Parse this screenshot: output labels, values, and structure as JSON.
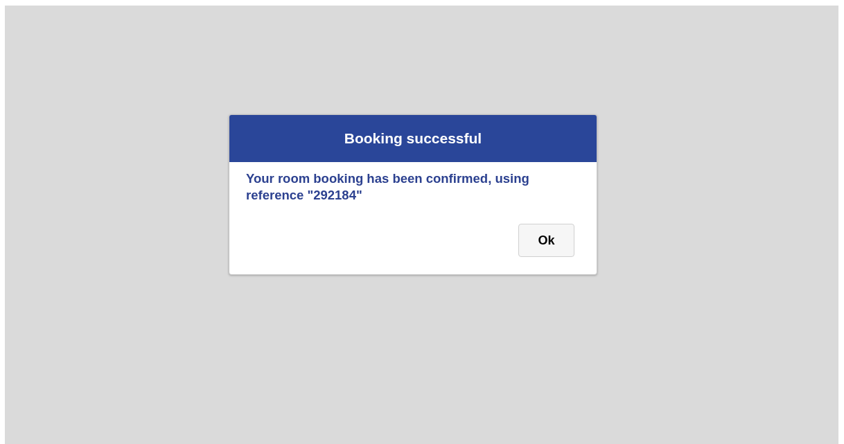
{
  "dialog": {
    "title": "Booking successful",
    "message": "Your room booking has been confirmed, using reference \"292184\"",
    "buttons": [
      "Ok"
    ]
  }
}
